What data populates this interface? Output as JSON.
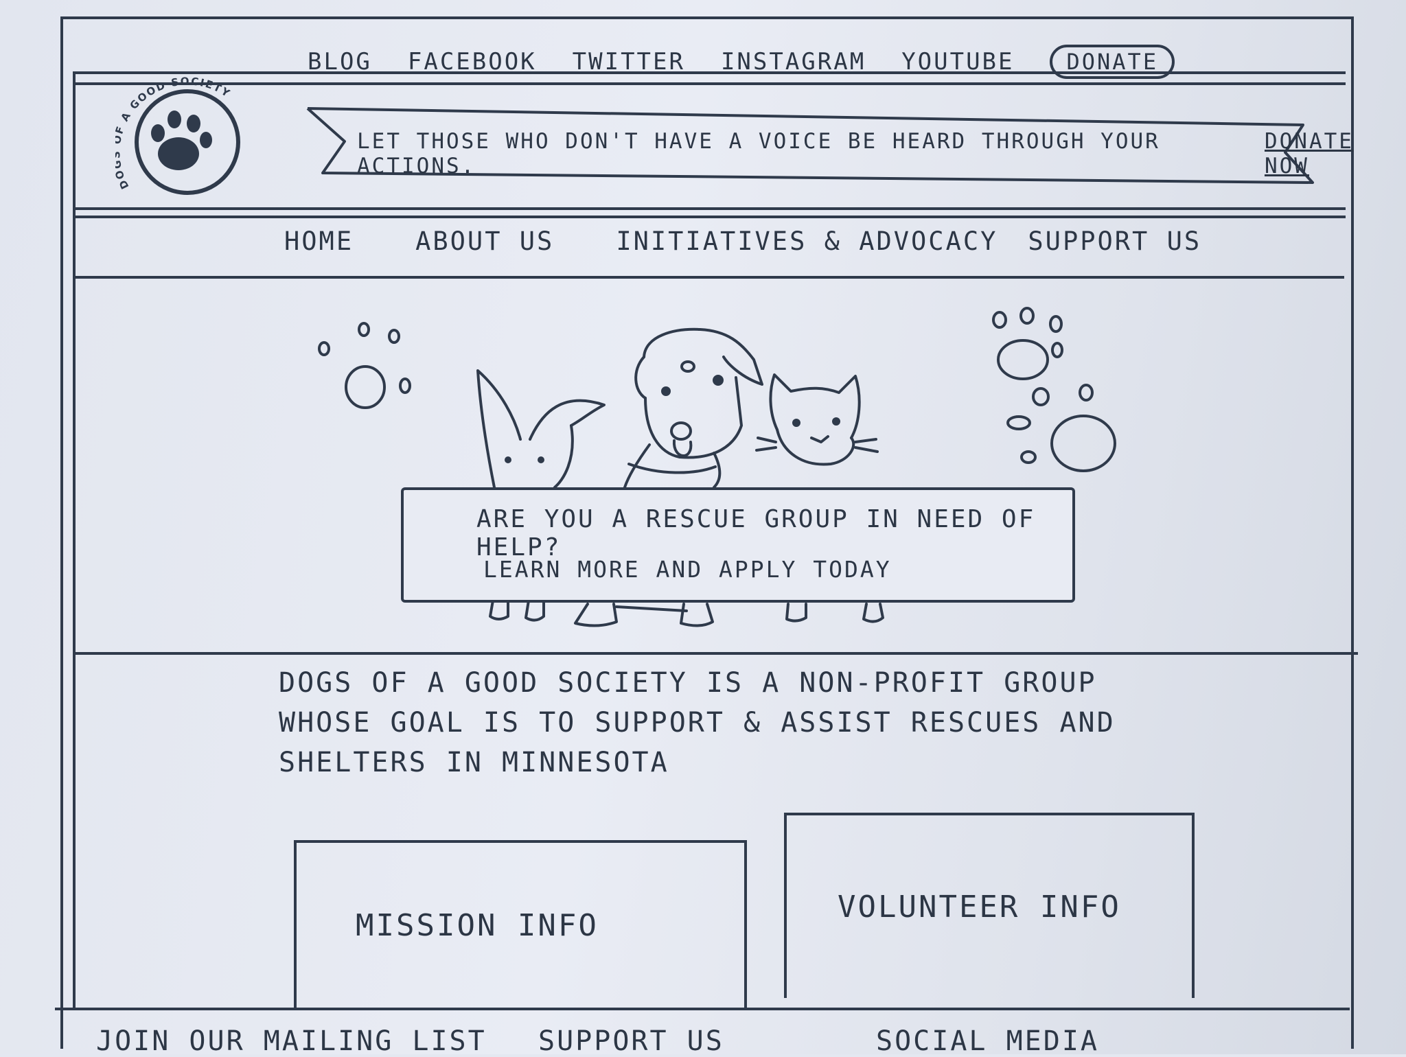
{
  "topbar": {
    "links": [
      "BLOG",
      "FACEBOOK",
      "TWITTER",
      "INSTAGRAM",
      "YOUTUBE"
    ],
    "donate_label": "DONATE"
  },
  "logo": {
    "text": "DOGS OF A GOOD SOCIETY",
    "icon": "paw-icon"
  },
  "banner": {
    "message": "LET THOSE WHO DON'T HAVE A VOICE BE HEARD THROUGH YOUR ACTIONS.",
    "link": "DONATE NOW"
  },
  "nav": {
    "items": [
      "HOME",
      "ABOUT US",
      "INITIATIVES & ADVOCACY",
      "SUPPORT US"
    ]
  },
  "hero": {
    "question": "ARE YOU A RESCUE GROUP IN NEED OF HELP?",
    "cta": "LEARN MORE AND APPLY TODAY",
    "illustration": [
      "rabbit-icon",
      "dog-icon",
      "cat-icon",
      "paw-prints-icon"
    ]
  },
  "about": {
    "text": "DOGS OF A GOOD SOCIETY IS A NON-PROFIT GROUP WHOSE GOAL IS TO SUPPORT & ASSIST RESCUES AND SHELTERS IN MINNESOTA"
  },
  "info": {
    "mission": "MISSION INFO",
    "volunteer": "VOLUNTEER INFO"
  },
  "footer": {
    "mailing_list": "JOIN OUR MAILING LIST",
    "support": "SUPPORT US",
    "social": "SOCIAL MEDIA"
  },
  "colors": {
    "ink": "#2f3a4b",
    "paper": "#e4e8f1"
  }
}
